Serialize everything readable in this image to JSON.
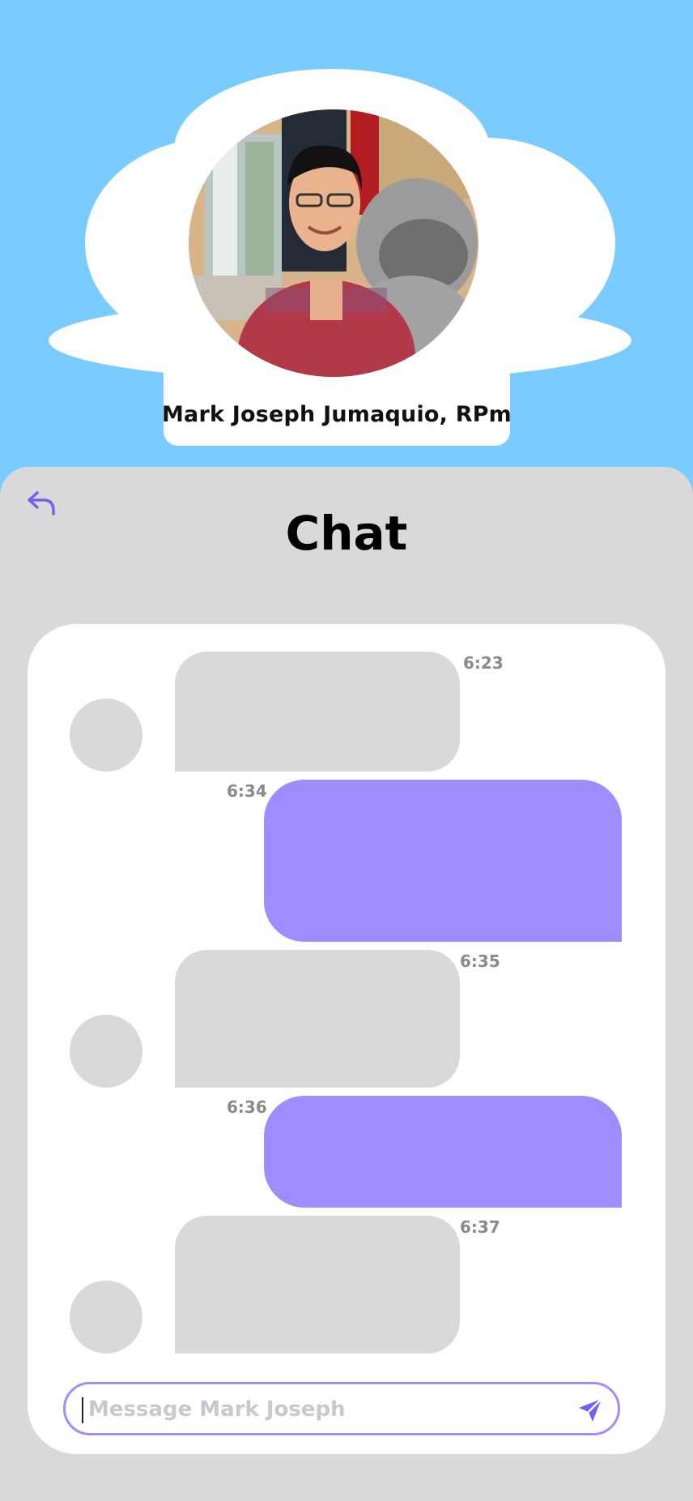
{
  "profile": {
    "name": "Mark Joseph Jumaquio, RPm"
  },
  "chat": {
    "title": "Chat",
    "messages": [
      {
        "direction": "incoming",
        "time": "6:23"
      },
      {
        "direction": "outgoing",
        "time": "6:34"
      },
      {
        "direction": "incoming",
        "time": "6:35"
      },
      {
        "direction": "outgoing",
        "time": "6:36"
      },
      {
        "direction": "incoming",
        "time": "6:37"
      }
    ]
  },
  "composer": {
    "placeholder": "Message Mark Joseph"
  },
  "icons": {
    "back": "reply-arrow-icon",
    "send": "send-icon"
  },
  "colors": {
    "sky": "#7acbff",
    "panel": "#d9d9d9",
    "accent": "#9e8dff",
    "icon_accent": "#7a5cf0"
  }
}
